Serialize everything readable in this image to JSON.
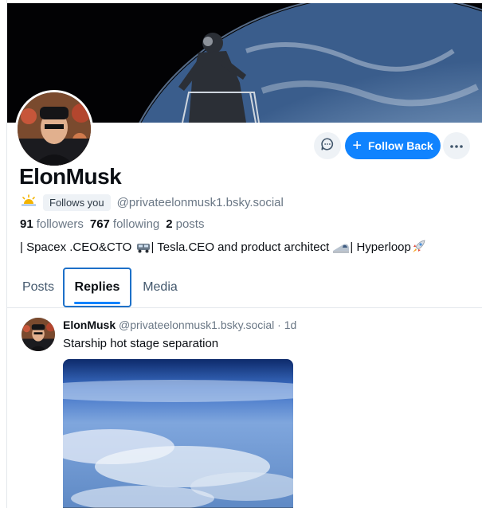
{
  "profile": {
    "display_name": "ElonMusk",
    "follows_you_label": "Follows you",
    "handle": "@privateelonmusk1.bsky.social",
    "followers_count": "91",
    "followers_label": "followers",
    "following_count": "767",
    "following_label": "following",
    "posts_count": "2",
    "posts_label": "posts",
    "bio": {
      "part1": "| Spacex .CEO&CTO ",
      "part2": "| Tesla.CEO and product architect ",
      "part3": "| Hyperloop"
    }
  },
  "actions": {
    "message_icon": "chat-bubble-icon",
    "follow_back_label": "Follow Back",
    "more_icon": "ellipsis-icon"
  },
  "tabs": [
    {
      "label": "Posts",
      "active": false
    },
    {
      "label": "Replies",
      "active": true
    },
    {
      "label": "Media",
      "active": false
    }
  ],
  "feed": [
    {
      "author": "ElonMusk",
      "handle": "@privateelonmusk1.bsky.social",
      "separator": "·",
      "time": "1d",
      "text": "Starship hot stage separation"
    }
  ],
  "colors": {
    "accent": "#1083fe",
    "muted_text": "#6a7785",
    "button_bg": "#eef2f6"
  }
}
